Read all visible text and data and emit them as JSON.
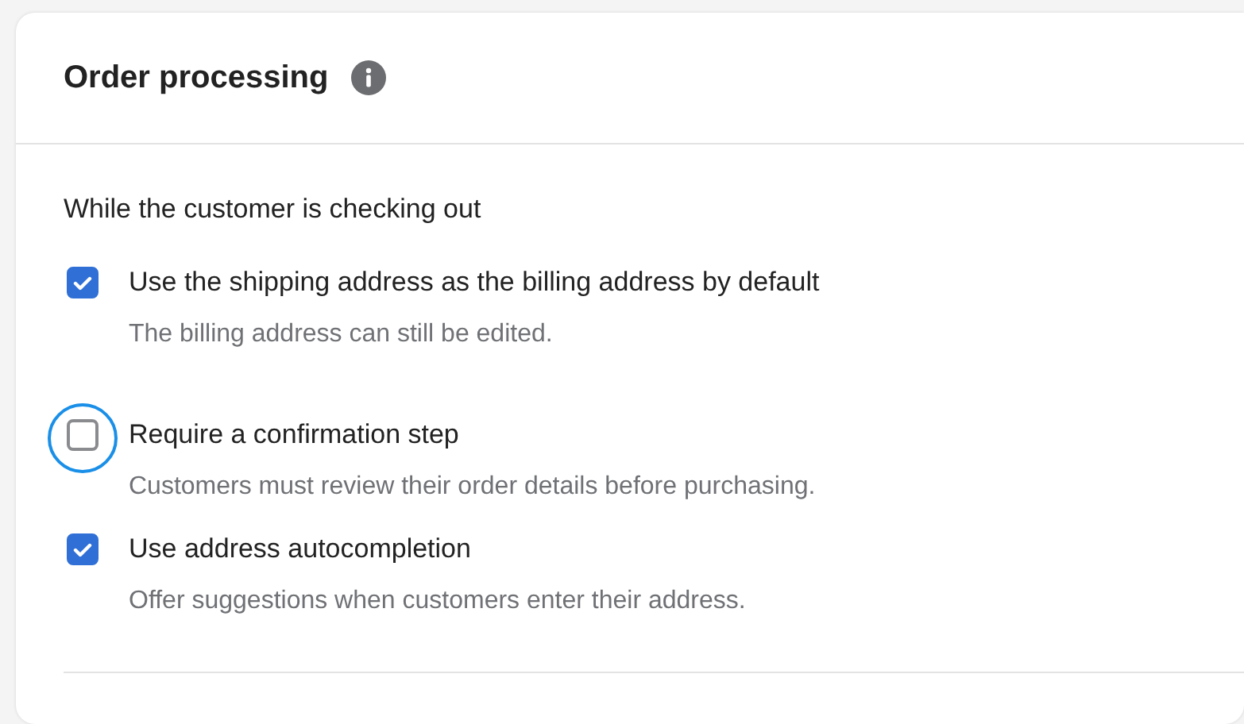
{
  "card": {
    "title": "Order processing",
    "section": "While the customer is checking out",
    "options": [
      {
        "label": "Use the shipping address as the billing address by default",
        "description": "The billing address can still be edited.",
        "checked": true,
        "focused": false
      },
      {
        "label": "Require a confirmation step",
        "description": "Customers must review their order details before purchasing.",
        "checked": false,
        "focused": true
      },
      {
        "label": "Use address autocompletion",
        "description": "Offer suggestions when customers enter their address.",
        "checked": true,
        "focused": false
      }
    ]
  }
}
